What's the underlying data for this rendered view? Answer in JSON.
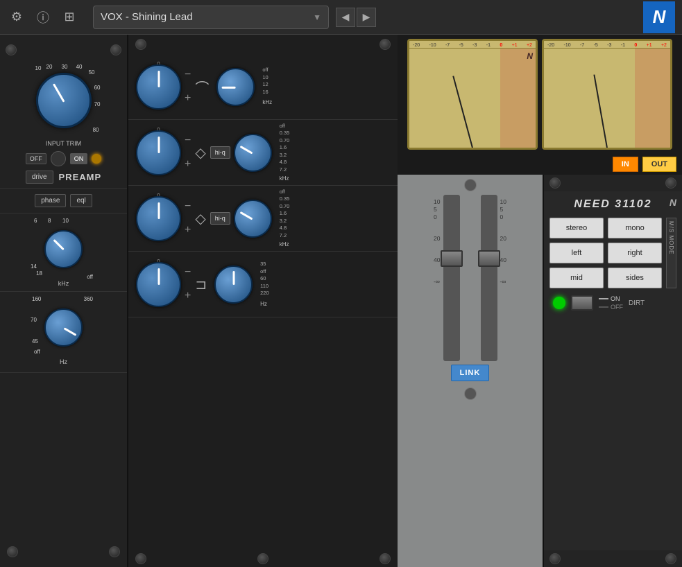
{
  "topbar": {
    "title": "VOX - Shining Lead",
    "settings_icon": "⚙",
    "info_icon": "ⓘ",
    "sliders_icon": "⊞",
    "arrow_left": "◀",
    "arrow_right": "▶",
    "n_logo": "N",
    "chevron": "▼"
  },
  "left_panel": {
    "input_trim_label": "INPUT TRIM",
    "scale_marks": [
      "10",
      "20",
      "30",
      "40",
      "50",
      "60",
      "70",
      "80"
    ],
    "off_label": "OFF",
    "on_label": "ON",
    "drive_label": "drive",
    "preamp_label": "PREAMP",
    "phase_label": "phase",
    "eql_label": "eql",
    "lp_scale_top": [
      "6",
      "8",
      "10"
    ],
    "lp_scale_bot": [
      "14",
      "18",
      "off"
    ],
    "khz_label": "kHz",
    "lp2_scale_top": [
      "160",
      "360"
    ],
    "lp2_scale_bot": [
      "70",
      "45",
      "off"
    ],
    "hz_label": "Hz"
  },
  "eq_panel": {
    "bands": [
      {
        "gain_label": "0",
        "minus": "-",
        "plus": "+",
        "freq_scale": [
          "off",
          "10",
          "12",
          "16"
        ],
        "khz": "kHz",
        "filter_type": "highpass"
      },
      {
        "gain_label": "0",
        "minus": "-",
        "plus": "+",
        "freq_scale": [
          "off",
          "0.35",
          "0.70",
          "1.6",
          "3.2",
          "4.8",
          "7.2"
        ],
        "khz": "kHz",
        "hi_q": "hi-q",
        "filter_type": "bell"
      },
      {
        "gain_label": "0",
        "minus": "-",
        "plus": "+",
        "freq_scale": [
          "off",
          "0.35",
          "0.70",
          "1.6",
          "3.2",
          "4.8",
          "7.2"
        ],
        "khz": "kHz",
        "hi_q": "hi-q",
        "filter_type": "bell"
      },
      {
        "gain_label": "0",
        "minus": "-",
        "plus": "+",
        "freq_scale": [
          "35",
          "off",
          "60",
          "110",
          "220"
        ],
        "hz": "Hz",
        "filter_type": "lowshelf"
      }
    ]
  },
  "vu_meters": {
    "left_scale": [
      "-20",
      "-10",
      "-7",
      "-5",
      "-3",
      "-1",
      "0",
      "+1",
      "+2"
    ],
    "right_scale": [
      "-20",
      "-10",
      "-7",
      "-5",
      "-3",
      "-1",
      "0",
      "+1",
      "+2"
    ],
    "n_logo": "N",
    "in_btn": "IN",
    "out_btn": "OUT"
  },
  "fader": {
    "left_scale": [
      "10",
      "5",
      "0",
      "",
      "",
      "20",
      "",
      "40",
      "-∞"
    ],
    "right_scale": [
      "10",
      "5",
      "0",
      "",
      "",
      "20",
      "",
      "40",
      "-∞"
    ],
    "link_btn": "LINK"
  },
  "need_panel": {
    "title": "NEED 31102",
    "n_logo": "N",
    "stereo_btn": "stereo",
    "mono_btn": "mono",
    "left_btn": "left",
    "right_btn": "right",
    "mid_btn": "mid",
    "sides_btn": "sides",
    "ms_mode_label": "M/S MODE",
    "dirt_label": "DIRT",
    "on_label": "ON",
    "off_label": "OFF"
  }
}
